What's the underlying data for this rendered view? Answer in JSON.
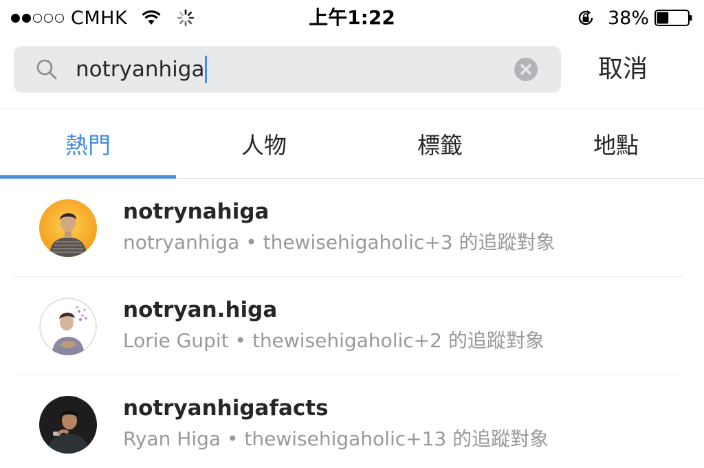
{
  "status_bar": {
    "carrier": "CMHK",
    "time": "上午1:22",
    "battery_percent": "38%",
    "battery_level": 0.38,
    "signal_bars": 2,
    "signal_total": 5,
    "icons": [
      "wifi-icon",
      "activity-spinner-icon",
      "rotation-lock-icon",
      "battery-icon"
    ]
  },
  "search": {
    "query": "notryanhiga",
    "cancel_label": "取消",
    "icons": [
      "search-icon",
      "clear-icon"
    ]
  },
  "tabs": [
    {
      "label": "熱門",
      "active": true
    },
    {
      "label": "人物",
      "active": false
    },
    {
      "label": "標籤",
      "active": false
    },
    {
      "label": "地點",
      "active": false
    }
  ],
  "results": [
    {
      "username": "notrynahiga",
      "subtitle": "notryanhiga • thewisehigaholic+3 的追蹤對象"
    },
    {
      "username": "notryan.higa",
      "subtitle": "Lorie Gupit • thewisehigaholic+2 的追蹤對象"
    },
    {
      "username": "notryanhigafacts",
      "subtitle": "Ryan Higa • thewisehigaholic+13 的追蹤對象"
    }
  ],
  "colors": {
    "accent": "#4a90e2",
    "active_tab_text": "#3f8ae0",
    "search_bg": "#e8e9eb",
    "subtitle": "#999999"
  }
}
